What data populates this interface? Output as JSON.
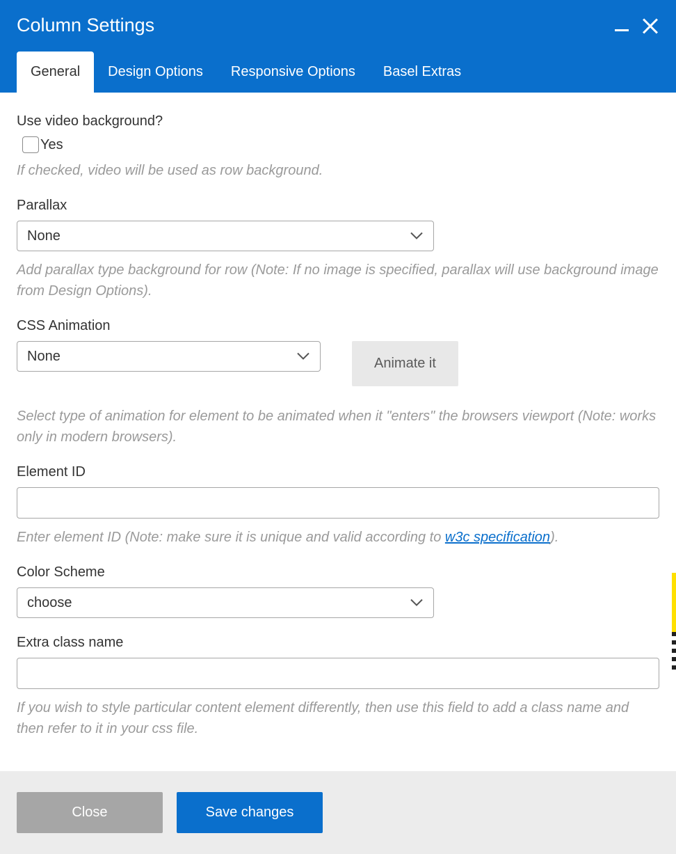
{
  "dialog": {
    "title": "Column Settings"
  },
  "tabs": {
    "general": "General",
    "design": "Design Options",
    "responsive": "Responsive Options",
    "basel": "Basel Extras"
  },
  "fields": {
    "videoBg": {
      "label": "Use video background?",
      "checkbox_label": "Yes",
      "help": "If checked, video will be used as row background."
    },
    "parallax": {
      "label": "Parallax",
      "value": "None",
      "help": "Add parallax type background for row (Note: If no image is specified, parallax will use background image from Design Options)."
    },
    "cssAnimation": {
      "label": "CSS Animation",
      "value": "None",
      "button": "Animate it",
      "help": "Select type of animation for element to be animated when it \"enters\" the browsers viewport (Note: works only in modern browsers)."
    },
    "elementId": {
      "label": "Element ID",
      "value": "",
      "help_prefix": "Enter element ID (Note: make sure it is unique and valid according to ",
      "help_link": "w3c specification",
      "help_suffix": ")."
    },
    "colorScheme": {
      "label": "Color Scheme",
      "value": "choose"
    },
    "extraClass": {
      "label": "Extra class name",
      "value": "",
      "help": "If you wish to style particular content element differently, then use this field to add a class name and then refer to it in your css file."
    }
  },
  "footer": {
    "close": "Close",
    "save": "Save changes"
  }
}
